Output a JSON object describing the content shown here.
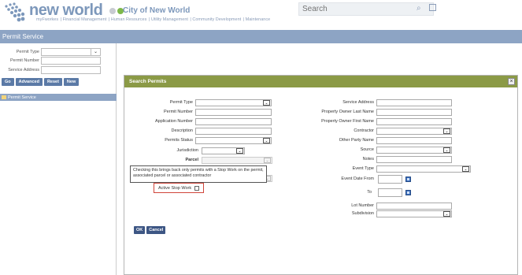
{
  "header": {
    "brand": "new world",
    "tagline": "myFworkes",
    "city": "City of New World",
    "search_placeholder": "Search",
    "nav": [
      "myFworkes",
      "Financial Management",
      "Human Resources",
      "Utility Management",
      "Community Development",
      "Maintenance"
    ],
    "brand_colors": [
      "#c8cbd1",
      "#7db84a"
    ],
    "icons": [
      "search-icon",
      "edit-icon"
    ]
  },
  "titlebar": {
    "title": "Permit Service"
  },
  "left_panel": {
    "fields": [
      {
        "label": "Permit Type",
        "type": "select",
        "value": ""
      },
      {
        "label": "Permit Number",
        "type": "text",
        "value": ""
      },
      {
        "label": "Service Address",
        "type": "text",
        "value": ""
      }
    ],
    "buttons": [
      "Go",
      "Advanced",
      "Reset",
      "New"
    ],
    "tree_item": "Permit Service"
  },
  "dialog": {
    "title": "Search Permits",
    "close": "×",
    "left_fields": [
      {
        "label": "Permit Type"
      },
      {
        "label": "Permit Number"
      },
      {
        "label": "Application Number"
      },
      {
        "label": "Description"
      },
      {
        "label": "Permits Status"
      },
      {
        "label": "Jurisdiction"
      },
      {
        "label": "Parcel"
      }
    ],
    "right_fields": [
      {
        "label": "Service Address"
      },
      {
        "label": "Property Owner Last Name"
      },
      {
        "label": "Property Owner First Name"
      },
      {
        "label": "Contractor"
      },
      {
        "label": "Other Party Name"
      },
      {
        "label": "Source"
      },
      {
        "label": "Notes"
      },
      {
        "label": "Event Type"
      },
      {
        "label": "Event Date From"
      },
      {
        "label": "To"
      },
      {
        "label": "Lot Number"
      },
      {
        "label": "Subdivision"
      }
    ],
    "tooltip": "Checking this brings back only permits with a Stop Work on the permit, associated parcel or associated contractor",
    "active_stop_work_label": "Active Stop Work",
    "buttons": [
      "OK",
      "Cancel"
    ]
  }
}
